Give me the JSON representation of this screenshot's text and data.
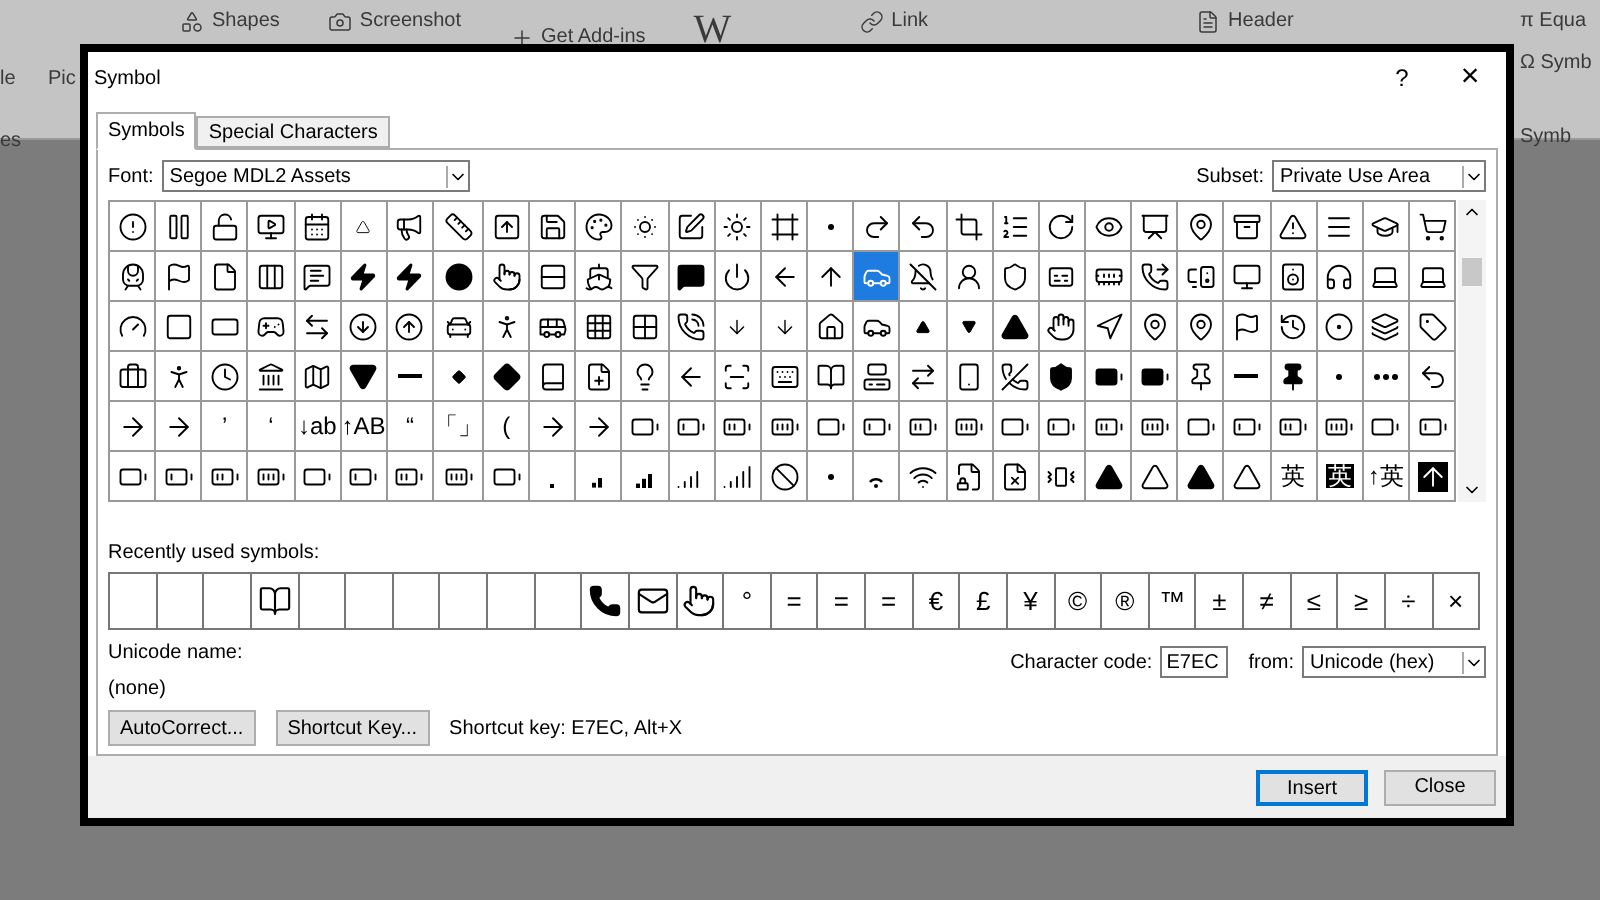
{
  "ribbon": {
    "items": [
      {
        "label": "Pic"
      },
      {
        "label": "Shapes"
      },
      {
        "label": "Screenshot"
      },
      {
        "label": "Get Add-ins"
      },
      {
        "label": "W"
      },
      {
        "label": "Link"
      },
      {
        "label": "Header"
      },
      {
        "label": "π Equa"
      },
      {
        "label": "Ω Symb"
      }
    ],
    "left_labels": [
      {
        "label": "le"
      },
      {
        "label": "es"
      }
    ],
    "group_label": "Symb"
  },
  "dialog": {
    "title": "Symbol",
    "help": "?",
    "close": "×",
    "tabs": [
      {
        "label": "Symbols",
        "selected": true
      },
      {
        "label": "Special Characters",
        "selected": false
      }
    ],
    "font": {
      "label": "Font:",
      "value": "Segoe MDL2 Assets"
    },
    "subset": {
      "label": "Subset:",
      "value": "Private Use Area"
    },
    "grid": {
      "rows": [
        {
          "cells": [
            {
              "kind": "icon",
              "selected": false
            },
            {
              "kind": "icon",
              "selected": false
            },
            {
              "kind": "icon",
              "selected": false
            },
            {
              "kind": "icon",
              "selected": false
            },
            {
              "kind": "icon",
              "selected": false
            },
            {
              "kind": "icon",
              "selected": false
            },
            {
              "kind": "icon",
              "selected": false
            },
            {
              "kind": "icon",
              "selected": false
            },
            {
              "kind": "icon",
              "selected": false
            },
            {
              "kind": "icon",
              "selected": false
            },
            {
              "kind": "icon",
              "selected": false
            },
            {
              "kind": "icon",
              "selected": false
            },
            {
              "kind": "icon",
              "selected": false
            },
            {
              "kind": "icon",
              "selected": false
            },
            {
              "kind": "icon",
              "selected": false
            },
            {
              "kind": "icon",
              "selected": false
            },
            {
              "kind": "icon",
              "selected": false
            },
            {
              "kind": "icon",
              "selected": false
            },
            {
              "kind": "icon",
              "selected": false
            },
            {
              "kind": "icon",
              "selected": false
            },
            {
              "kind": "icon",
              "selected": false
            },
            {
              "kind": "icon",
              "selected": false
            },
            {
              "kind": "icon",
              "selected": false
            },
            {
              "kind": "icon",
              "selected": false
            },
            {
              "kind": "icon",
              "selected": false
            },
            {
              "kind": "icon",
              "selected": false
            },
            {
              "kind": "icon",
              "selected": false
            },
            {
              "kind": "icon",
              "selected": false
            },
            {
              "kind": "icon",
              "selected": false
            }
          ]
        },
        {
          "cells": [
            {
              "kind": "icon",
              "selected": false
            },
            {
              "kind": "icon",
              "selected": false
            },
            {
              "kind": "icon",
              "selected": false
            },
            {
              "kind": "icon",
              "selected": false
            },
            {
              "kind": "icon",
              "selected": false
            },
            {
              "kind": "icon",
              "selected": false
            },
            {
              "kind": "icon",
              "selected": false
            },
            {
              "kind": "icon",
              "selected": false
            },
            {
              "kind": "icon",
              "selected": false
            },
            {
              "kind": "icon",
              "selected": false
            },
            {
              "kind": "icon",
              "selected": false
            },
            {
              "kind": "icon",
              "selected": false
            },
            {
              "kind": "icon",
              "selected": false
            },
            {
              "kind": "icon",
              "selected": false
            },
            {
              "kind": "icon",
              "selected": false
            },
            {
              "kind": "icon",
              "selected": false
            },
            {
              "kind": "icon",
              "selected": true
            },
            {
              "kind": "icon",
              "selected": false
            },
            {
              "kind": "icon",
              "selected": false
            },
            {
              "kind": "icon",
              "selected": false
            },
            {
              "kind": "icon",
              "selected": false
            },
            {
              "kind": "icon",
              "selected": false
            },
            {
              "kind": "icon",
              "selected": false
            },
            {
              "kind": "icon",
              "selected": false
            },
            {
              "kind": "icon",
              "selected": false
            },
            {
              "kind": "icon",
              "selected": false
            },
            {
              "kind": "icon",
              "selected": false
            },
            {
              "kind": "icon",
              "selected": false
            },
            {
              "kind": "icon",
              "selected": false
            }
          ]
        },
        {
          "cells": [
            {
              "kind": "icon",
              "selected": false
            },
            {
              "kind": "icon",
              "selected": false
            },
            {
              "kind": "icon",
              "selected": false
            },
            {
              "kind": "icon",
              "selected": false
            },
            {
              "kind": "icon",
              "selected": false
            },
            {
              "kind": "icon",
              "selected": false
            },
            {
              "kind": "icon",
              "selected": false
            },
            {
              "kind": "icon",
              "selected": false
            },
            {
              "kind": "icon",
              "selected": false
            },
            {
              "kind": "icon",
              "selected": false
            },
            {
              "kind": "icon",
              "selected": false
            },
            {
              "kind": "icon",
              "selected": false
            },
            {
              "kind": "icon",
              "selected": false
            },
            {
              "kind": "icon",
              "selected": false
            },
            {
              "kind": "icon",
              "selected": false
            },
            {
              "kind": "icon",
              "selected": false
            },
            {
              "kind": "icon",
              "selected": false
            },
            {
              "kind": "icon",
              "selected": false
            },
            {
              "kind": "icon",
              "selected": false
            },
            {
              "kind": "icon",
              "selected": false
            },
            {
              "kind": "icon",
              "selected": false
            },
            {
              "kind": "icon",
              "selected": false
            },
            {
              "kind": "icon",
              "selected": false
            },
            {
              "kind": "icon",
              "selected": false
            },
            {
              "kind": "icon",
              "selected": false
            },
            {
              "kind": "icon",
              "selected": false
            },
            {
              "kind": "icon",
              "selected": false
            },
            {
              "kind": "icon",
              "selected": false
            },
            {
              "kind": "icon",
              "selected": false
            }
          ]
        },
        {
          "cells": [
            {
              "kind": "icon",
              "selected": false
            },
            {
              "kind": "icon",
              "selected": false
            },
            {
              "kind": "icon",
              "selected": false
            },
            {
              "kind": "icon",
              "selected": false
            },
            {
              "kind": "icon",
              "selected": false
            },
            {
              "kind": "icon",
              "selected": false
            },
            {
              "kind": "icon",
              "selected": false
            },
            {
              "kind": "icon",
              "selected": false
            },
            {
              "kind": "icon",
              "selected": false
            },
            {
              "kind": "icon",
              "selected": false
            },
            {
              "kind": "icon",
              "selected": false
            },
            {
              "kind": "icon",
              "selected": false
            },
            {
              "kind": "icon",
              "selected": false
            },
            {
              "kind": "icon",
              "selected": false
            },
            {
              "kind": "icon",
              "selected": false
            },
            {
              "kind": "icon",
              "selected": false
            },
            {
              "kind": "icon",
              "selected": false
            },
            {
              "kind": "icon",
              "selected": false
            },
            {
              "kind": "icon",
              "selected": false
            },
            {
              "kind": "icon",
              "selected": false
            },
            {
              "kind": "icon",
              "selected": false
            },
            {
              "kind": "icon",
              "selected": false
            },
            {
              "kind": "icon",
              "selected": false
            },
            {
              "kind": "icon",
              "selected": false
            },
            {
              "kind": "icon",
              "selected": false
            },
            {
              "kind": "icon",
              "selected": false
            },
            {
              "kind": "icon",
              "selected": false
            },
            {
              "kind": "icon",
              "selected": false
            },
            {
              "kind": "icon",
              "selected": false
            }
          ]
        },
        {
          "cells": [
            {
              "kind": "icon",
              "selected": false
            },
            {
              "kind": "icon",
              "selected": false
            },
            {
              "kind": "text",
              "glyph": "’",
              "inverted": false,
              "selected": false
            },
            {
              "kind": "text",
              "glyph": "‘",
              "inverted": false,
              "selected": false
            },
            {
              "kind": "text",
              "glyph": "↓ab",
              "inverted": false,
              "selected": false
            },
            {
              "kind": "text",
              "glyph": "↑AB",
              "inverted": false,
              "selected": false
            },
            {
              "kind": "text",
              "glyph": "“",
              "inverted": false,
              "selected": false
            },
            {
              "kind": "text",
              "glyph": "「」",
              "inverted": false,
              "selected": false
            },
            {
              "kind": "text",
              "glyph": "(",
              "inverted": false,
              "selected": false
            },
            {
              "kind": "icon",
              "selected": false
            },
            {
              "kind": "icon",
              "selected": false
            },
            {
              "kind": "icon",
              "selected": false
            },
            {
              "kind": "icon",
              "selected": false
            },
            {
              "kind": "icon",
              "selected": false
            },
            {
              "kind": "icon",
              "selected": false
            },
            {
              "kind": "icon",
              "selected": false
            },
            {
              "kind": "icon",
              "selected": false
            },
            {
              "kind": "icon",
              "selected": false
            },
            {
              "kind": "icon",
              "selected": false
            },
            {
              "kind": "icon",
              "selected": false
            },
            {
              "kind": "icon",
              "selected": false
            },
            {
              "kind": "icon",
              "selected": false
            },
            {
              "kind": "icon",
              "selected": false
            },
            {
              "kind": "icon",
              "selected": false
            },
            {
              "kind": "icon",
              "selected": false
            },
            {
              "kind": "icon",
              "selected": false
            },
            {
              "kind": "icon",
              "selected": false
            },
            {
              "kind": "icon",
              "selected": false
            },
            {
              "kind": "icon",
              "selected": false
            }
          ]
        },
        {
          "cells": [
            {
              "kind": "icon",
              "selected": false
            },
            {
              "kind": "icon",
              "selected": false
            },
            {
              "kind": "icon",
              "selected": false
            },
            {
              "kind": "icon",
              "selected": false
            },
            {
              "kind": "icon",
              "selected": false
            },
            {
              "kind": "icon",
              "selected": false
            },
            {
              "kind": "icon",
              "selected": false
            },
            {
              "kind": "icon",
              "selected": false
            },
            {
              "kind": "icon",
              "selected": false
            },
            {
              "kind": "icon",
              "selected": false
            },
            {
              "kind": "icon",
              "selected": false
            },
            {
              "kind": "icon",
              "selected": false
            },
            {
              "kind": "icon",
              "selected": false
            },
            {
              "kind": "icon",
              "selected": false
            },
            {
              "kind": "icon",
              "selected": false
            },
            {
              "kind": "icon",
              "selected": false
            },
            {
              "kind": "icon",
              "selected": false
            },
            {
              "kind": "icon",
              "selected": false
            },
            {
              "kind": "icon",
              "selected": false
            },
            {
              "kind": "icon",
              "selected": false
            },
            {
              "kind": "icon",
              "selected": false
            },
            {
              "kind": "icon",
              "selected": false
            },
            {
              "kind": "icon",
              "selected": false
            },
            {
              "kind": "icon",
              "selected": false
            },
            {
              "kind": "icon",
              "selected": false
            },
            {
              "kind": "text",
              "glyph": "英",
              "inverted": false,
              "selected": false
            },
            {
              "kind": "text",
              "glyph": "英",
              "inverted": true,
              "selected": false
            },
            {
              "kind": "text",
              "glyph": "↑英",
              "inverted": false,
              "selected": false
            },
            {
              "kind": "icon",
              "selected": false
            }
          ]
        }
      ]
    },
    "recent": {
      "label": "Recently used symbols:",
      "cells": [
        {
          "kind": "empty",
          "selected": false
        },
        {
          "kind": "empty",
          "selected": false
        },
        {
          "kind": "empty",
          "selected": false
        },
        {
          "kind": "icon",
          "selected": false
        },
        {
          "kind": "empty",
          "selected": false
        },
        {
          "kind": "empty",
          "selected": false
        },
        {
          "kind": "empty",
          "selected": false
        },
        {
          "kind": "empty",
          "selected": false
        },
        {
          "kind": "empty",
          "selected": false
        },
        {
          "kind": "empty",
          "selected": false
        },
        {
          "kind": "icon",
          "selected": false
        },
        {
          "kind": "icon",
          "selected": false
        },
        {
          "kind": "icon",
          "selected": false
        },
        {
          "kind": "text",
          "glyph": "°",
          "selected": false
        },
        {
          "kind": "text",
          "glyph": "=",
          "selected": false
        },
        {
          "kind": "text",
          "glyph": "=",
          "selected": false
        },
        {
          "kind": "text",
          "glyph": "=",
          "selected": false
        },
        {
          "kind": "text",
          "glyph": "€",
          "selected": false
        },
        {
          "kind": "text",
          "glyph": "£",
          "selected": false
        },
        {
          "kind": "text",
          "glyph": "¥",
          "selected": false
        },
        {
          "kind": "text",
          "glyph": "©",
          "selected": false
        },
        {
          "kind": "text",
          "glyph": "®",
          "selected": false
        },
        {
          "kind": "text",
          "glyph": "™",
          "selected": false
        },
        {
          "kind": "text",
          "glyph": "±",
          "selected": false
        },
        {
          "kind": "text",
          "glyph": "≠",
          "selected": false
        },
        {
          "kind": "text",
          "glyph": "≤",
          "selected": false
        },
        {
          "kind": "text",
          "glyph": "≥",
          "selected": false
        },
        {
          "kind": "text",
          "glyph": "÷",
          "selected": false
        },
        {
          "kind": "text",
          "glyph": "×",
          "selected": false
        }
      ]
    },
    "unicode_name": {
      "label": "Unicode name:",
      "value": "(none)"
    },
    "character_code": {
      "label": "Character code:",
      "value": "E7EC"
    },
    "from": {
      "label": "from:",
      "value": "Unicode (hex)"
    },
    "buttons": [
      {
        "label": "AutoCorrect..."
      },
      {
        "label": "Shortcut Key..."
      }
    ],
    "shortcut_text": "Shortcut key: E7EC, Alt+X",
    "footer_buttons": [
      {
        "label": "Insert",
        "default": true
      },
      {
        "label": "Close",
        "default": false
      }
    ]
  }
}
